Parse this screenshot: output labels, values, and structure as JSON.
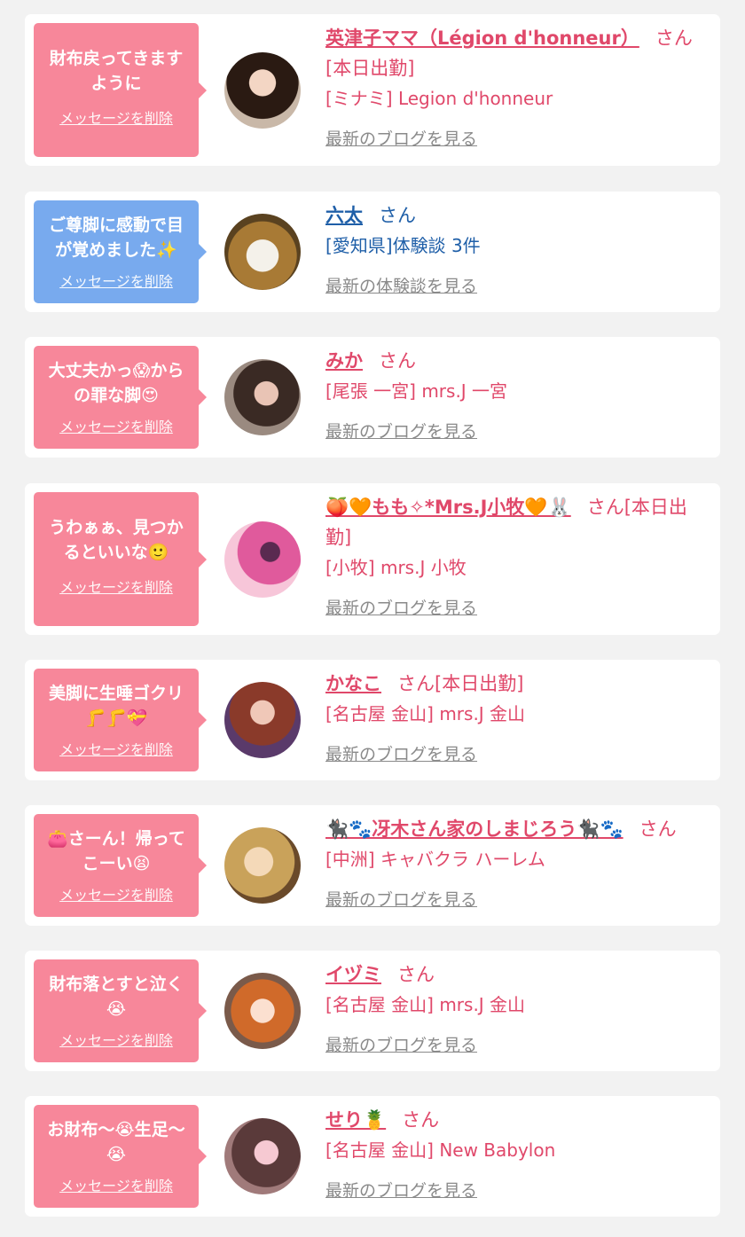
{
  "colors": {
    "pink_accent": "#e0486a",
    "pink_bubble": "#f7879a",
    "blue_accent": "#1f5fa8",
    "blue_bubble": "#78aaee",
    "link_gray": "#8a8a8a",
    "background": "#f2f2f2"
  },
  "common": {
    "delete_label": "メッセージを削除",
    "san_suffix": "さん"
  },
  "cards": [
    {
      "color": "pink",
      "message": "財布戻ってきます\nように",
      "name": "英津子ママ（Légion d'honneur）",
      "suffix": "さん[本日出勤]",
      "shop": "[ミナミ] Legion d'honneur",
      "link": "最新のブログを見る",
      "avatar_icon": "woman-portrait-avatar"
    },
    {
      "color": "blue",
      "message": "ご尊脚に感動で目\nが覚めました✨",
      "name": "六太",
      "suffix": "さん",
      "shop": "[愛知県]体験談 3件",
      "link": "最新の体験談を見る",
      "avatar_icon": "food-photo-avatar"
    },
    {
      "color": "pink",
      "message": "大丈夫かっ😱から\nの罪な脚😍",
      "name": "みか",
      "suffix": "さん",
      "shop": "[尾張 一宮] mrs.J 一宮",
      "link": "最新のブログを見る",
      "avatar_icon": "woman-selfie-avatar"
    },
    {
      "color": "pink",
      "message": "うわぁぁ、見つか\nるといいな🙂",
      "name": "🍑🧡もも✧*Mrs.J小牧🧡🐰",
      "suffix": "さん[本日出勤]",
      "shop": "[小牧] mrs.J 小牧",
      "link": "最新のブログを見る",
      "avatar_icon": "pink-photo-avatar"
    },
    {
      "color": "pink",
      "message": "美脚に生唾ゴクリ\n🦵🦵💝",
      "name": "かなこ",
      "suffix": "さん[本日出勤]",
      "shop": "[名古屋 金山] mrs.J 金山",
      "link": "最新のブログを見る",
      "avatar_icon": "woman-kimono-avatar"
    },
    {
      "color": "pink",
      "message": "👛さーん！帰って\nこーい😫",
      "name": "🐈‍⬛🐾冴木さん家のしまじろう🐈‍⬛🐾",
      "suffix": "さん",
      "shop": "[中洲] キャバクラ ハーレム",
      "link": "最新のブログを見る",
      "avatar_icon": "blonde-woman-avatar"
    },
    {
      "color": "pink",
      "message": "財布落とすと泣く\n😭",
      "name": "イヅミ",
      "suffix": "さん",
      "shop": "[名古屋 金山] mrs.J 金山",
      "link": "最新のブログを見る",
      "avatar_icon": "redhair-woman-avatar"
    },
    {
      "color": "pink",
      "message": "お財布〜😭生足〜\n😭",
      "name": "せり🍍",
      "suffix": "さん",
      "shop": "[名古屋 金山] New Babylon",
      "link": "最新のブログを見る",
      "avatar_icon": "woman-closeup-avatar"
    }
  ]
}
